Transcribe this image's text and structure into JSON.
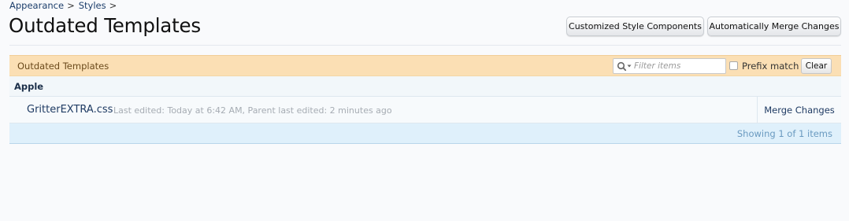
{
  "breadcrumb": {
    "items": [
      {
        "label": "Appearance"
      },
      {
        "label": "Styles"
      }
    ],
    "separator": ">"
  },
  "page": {
    "title": "Outdated Templates"
  },
  "toolbar": {
    "customized_label": "Customized Style Components",
    "merge_all_label": "Automatically Merge Changes"
  },
  "section": {
    "title": "Outdated Templates",
    "filter_placeholder": "Filter items",
    "prefix_match_label": "Prefix match",
    "prefix_match_checked": false,
    "clear_label": "Clear"
  },
  "groups": [
    {
      "label": "Apple",
      "items": [
        {
          "name": "GritterEXTRA.css",
          "meta": "Last edited: Today at 6:42 AM, Parent last edited: 2 minutes ago",
          "action": "Merge Changes"
        }
      ]
    }
  ],
  "footer": {
    "showing_text": "Showing 1 of 1 items"
  },
  "colors": {
    "header_bg": "#fbdfb4",
    "footer_bg": "#dff0fb",
    "link": "#1f3b63"
  }
}
